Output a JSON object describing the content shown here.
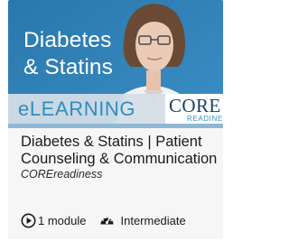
{
  "hero": {
    "title": "Diabetes\n& Statins",
    "band_label": "eLEARNING",
    "logo_main": "CORE",
    "logo_sub": "READINESS"
  },
  "course": {
    "title": "Diabetes & Statins | Patient Counseling & Communication",
    "provider": "COREreadiness"
  },
  "meta": {
    "modules": "1 module",
    "module_icon": "play-circle-icon",
    "level": "Intermediate",
    "level_icon": "speedometer-icon"
  },
  "colors": {
    "hero_blue": "#2f7fb3",
    "band_text": "#2f8ec0",
    "logo_navy": "#1f3f66"
  }
}
